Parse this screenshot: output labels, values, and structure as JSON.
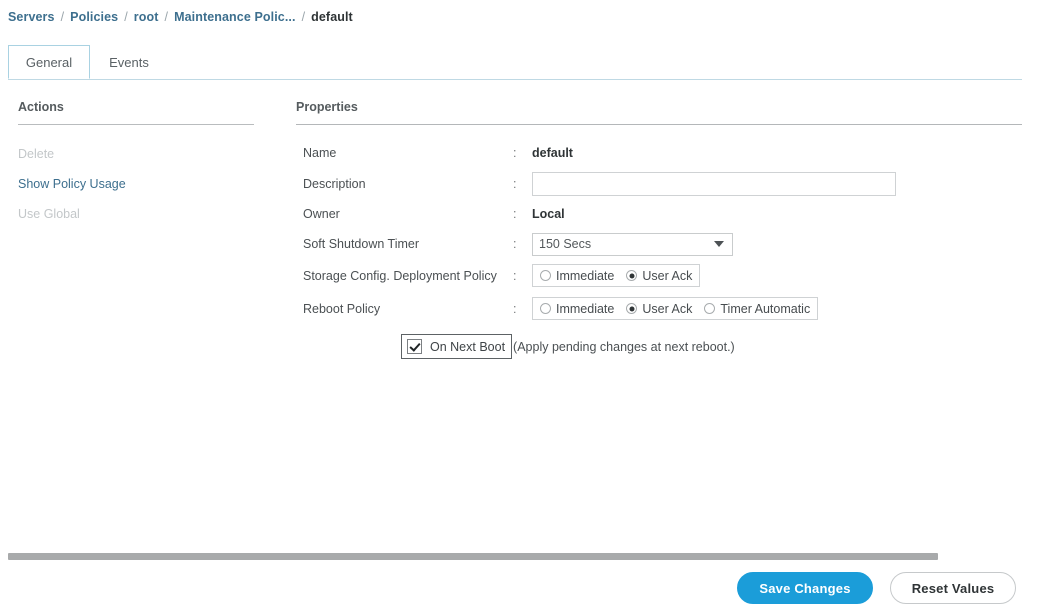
{
  "breadcrumb": {
    "separator": "/",
    "items": [
      {
        "label": "Servers",
        "current": false
      },
      {
        "label": "Policies",
        "current": false
      },
      {
        "label": "root",
        "current": false
      },
      {
        "label": "Maintenance Polic...",
        "current": false
      },
      {
        "label": "default",
        "current": true
      }
    ]
  },
  "tabs": [
    {
      "label": "General",
      "active": true
    },
    {
      "label": "Events",
      "active": false
    }
  ],
  "actions": {
    "title": "Actions",
    "items": [
      {
        "label": "Delete",
        "enabled": false
      },
      {
        "label": "Show Policy Usage",
        "enabled": true
      },
      {
        "label": "Use Global",
        "enabled": false
      }
    ]
  },
  "properties": {
    "title": "Properties",
    "colon": ":",
    "name": {
      "label": "Name",
      "value": "default"
    },
    "description": {
      "label": "Description",
      "value": "",
      "placeholder": ""
    },
    "owner": {
      "label": "Owner",
      "value": "Local"
    },
    "soft_shutdown_timer": {
      "label": "Soft Shutdown Timer",
      "value": "150 Secs",
      "options": [
        "150 Secs"
      ]
    },
    "storage_config_deployment_policy": {
      "label": "Storage Config. Deployment Policy",
      "options": [
        {
          "label": "Immediate",
          "selected": false
        },
        {
          "label": "User Ack",
          "selected": true
        }
      ]
    },
    "reboot_policy": {
      "label": "Reboot Policy",
      "options": [
        {
          "label": "Immediate",
          "selected": false
        },
        {
          "label": "User Ack",
          "selected": true
        },
        {
          "label": "Timer Automatic",
          "selected": false
        }
      ]
    },
    "on_next_boot": {
      "label": "On Next Boot",
      "checked": true,
      "hint": "(Apply pending changes at next reboot.)"
    }
  },
  "footer": {
    "save_label": "Save Changes",
    "reset_label": "Reset Values"
  },
  "colors": {
    "accent_blue": "#1b9dd9",
    "link_blue": "#3d6f8e",
    "tab_border": "#a9d2e2",
    "disabled_gray": "#c3c7c9",
    "scrollbar": "#a8aaab"
  }
}
